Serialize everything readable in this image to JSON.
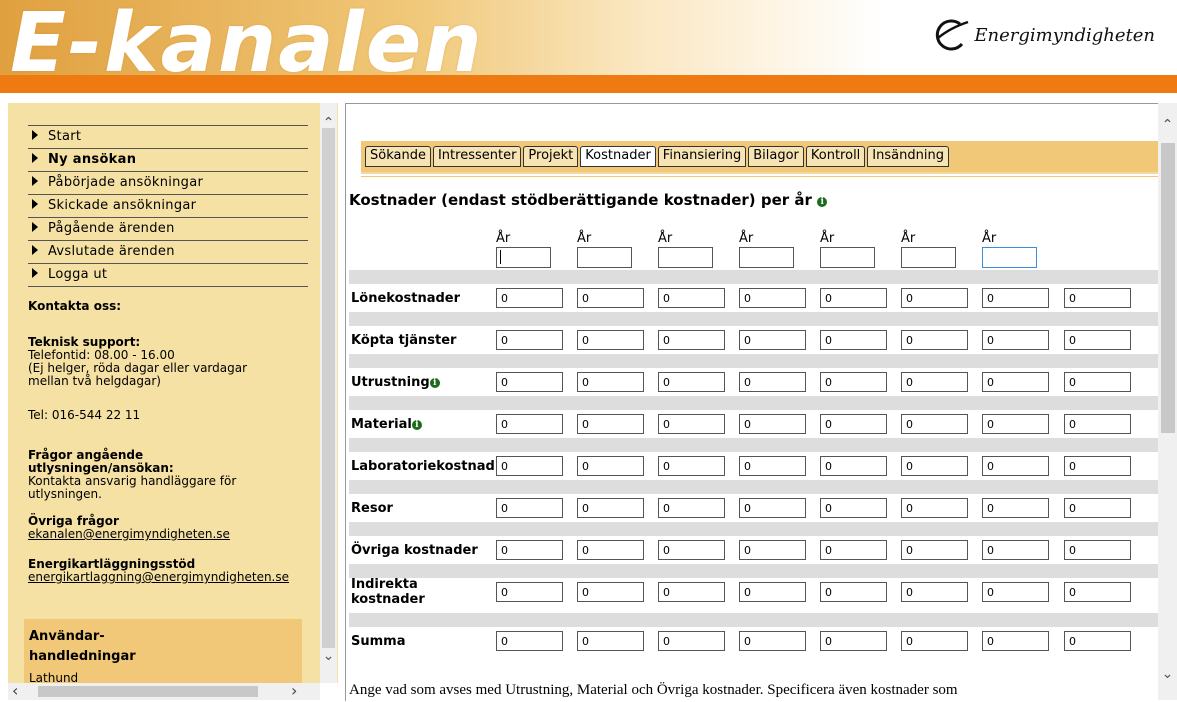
{
  "header": {
    "logo_text": "E-kanalen",
    "brand_name": "Energimyndigheten",
    "colors": {
      "orange": "#ef7a12",
      "sidebar": "#f6e1a4",
      "tabbar": "#f0c878"
    }
  },
  "nav": {
    "items": [
      {
        "label": "Start",
        "bold": false
      },
      {
        "label": "Ny ansökan",
        "bold": true
      },
      {
        "label": "Påbörjade ansökningar",
        "bold": false
      },
      {
        "label": "Skickade ansökningar",
        "bold": false
      },
      {
        "label": "Pågående ärenden",
        "bold": false
      },
      {
        "label": "Avslutade ärenden",
        "bold": false
      },
      {
        "label": "Logga ut",
        "bold": false
      }
    ]
  },
  "contact": {
    "title": "Kontakta oss:",
    "support_title": "Teknisk support:",
    "support_hours": "Telefontid: 08.00 - 16.00",
    "support_note": "(Ej helger, röda dagar eller vardagar mellan två helgdagar)",
    "phone": "Tel: 016-544 22 11",
    "call_title": "Frågor angående utlysningen/ansökan:",
    "call_text": "Kontakta ansvarig handläggare för utlysningen.",
    "other_title": "Övriga frågor",
    "other_email": "ekanalen@energimyndigheten.se",
    "audit_title": "Energikartläggningsstöd",
    "audit_email": "energikartlaggning@energimyndigheten.se",
    "manuals_title_1": "Användar-",
    "manuals_title_2": "handledningar",
    "manuals_link": "Lathund"
  },
  "tabs": [
    "Sökande",
    "Intressenter",
    "Projekt",
    "Kostnader",
    "Finansiering",
    "Bilagor",
    "Kontroll",
    "Insändning"
  ],
  "active_tab": "Kostnader",
  "main": {
    "heading": "Kostnader (endast stödberättigande kostnader) per år",
    "year_label": "År",
    "summa_header": "Summa",
    "rows": [
      {
        "label": "Lönekostnader",
        "info": false
      },
      {
        "label": "Köpta tjänster",
        "info": false
      },
      {
        "label": "Utrustning",
        "info": true
      },
      {
        "label": "Material",
        "info": true
      },
      {
        "label": "Laboratoriekostnad",
        "info": false
      },
      {
        "label": "Resor",
        "info": false
      },
      {
        "label": "Övriga kostnader",
        "info": false
      },
      {
        "label": "Indirekta kostnader",
        "info": false
      },
      {
        "label": "Summa",
        "info": false
      }
    ],
    "cell_value": "0",
    "bottom_text": "Ange vad som avses med Utrustning, Material och Övriga kostnader. Specificera även kostnader som"
  }
}
